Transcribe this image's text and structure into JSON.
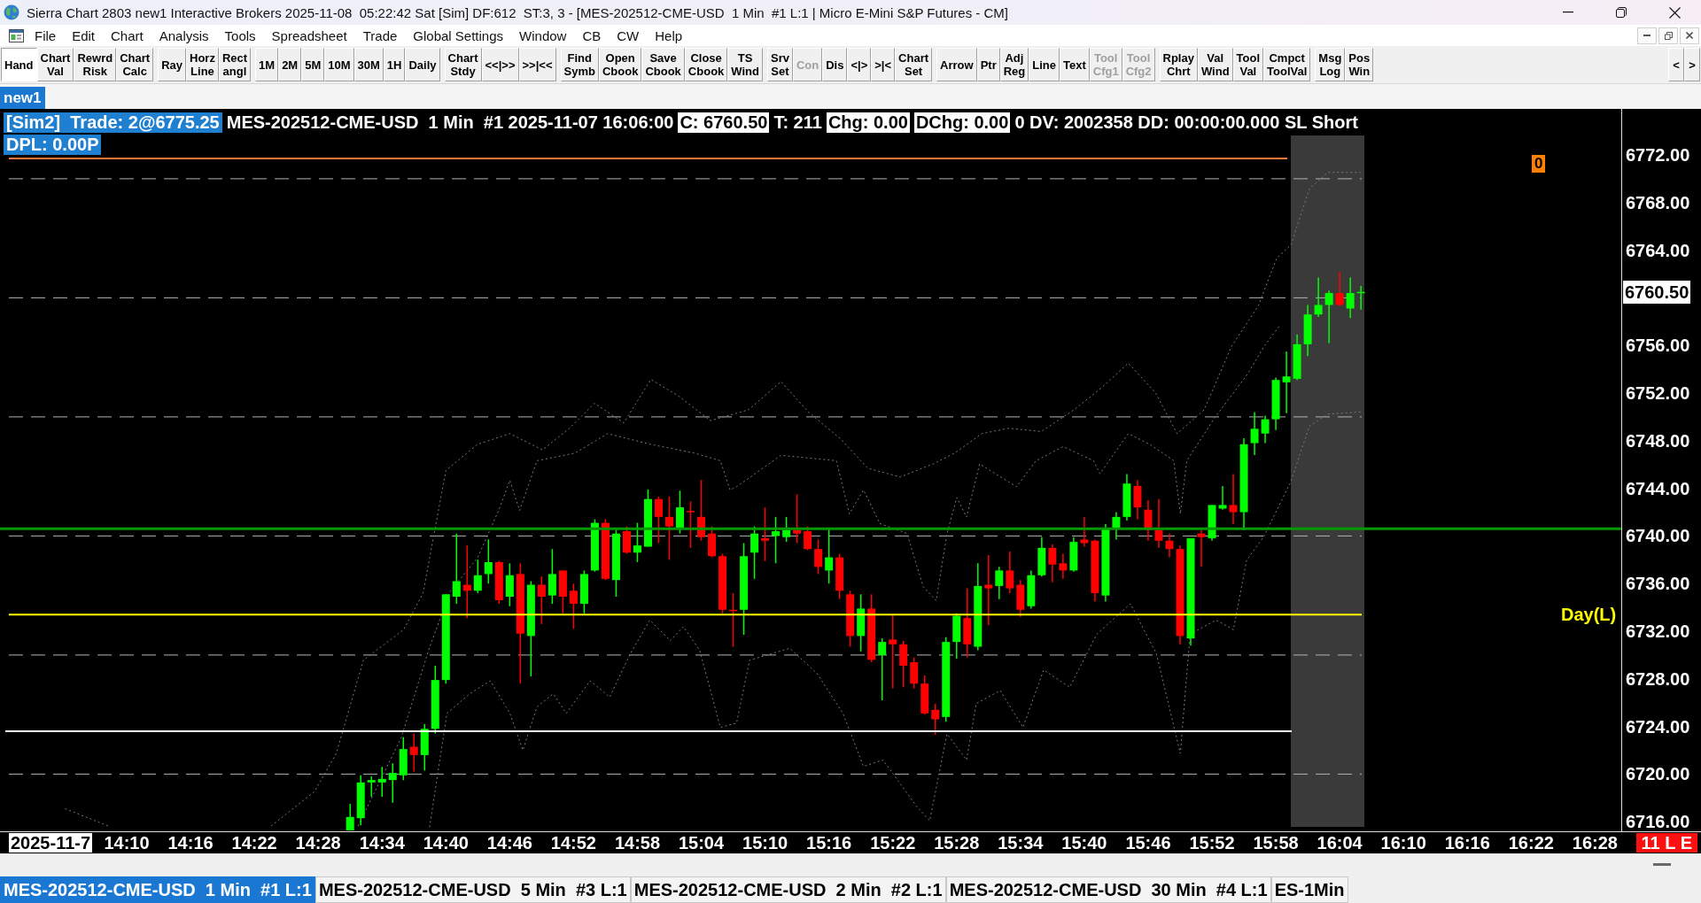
{
  "window": {
    "title": "Sierra Chart 2803 new1 Interactive Brokers 2025-11-08  05:22:42 Sat [Sim] DF:612  ST:3, 3 - [MES-202512-CME-USD  1 Min  #1 L:1 | Micro E-Mini S&P Futures - CM]"
  },
  "menu_bar": {
    "items": [
      "File",
      "Edit",
      "Chart",
      "Analysis",
      "Tools",
      "Spreadsheet",
      "Trade",
      "Global Settings",
      "Window",
      "CB",
      "CW",
      "Help"
    ]
  },
  "toolbar": {
    "groups": [
      [
        {
          "lines": [
            "Hand"
          ],
          "selected": true,
          "disabled": false
        },
        {
          "lines": [
            "Chart",
            "Val"
          ],
          "selected": false,
          "disabled": false
        },
        {
          "lines": [
            "Rewrd",
            "Risk"
          ],
          "selected": false,
          "disabled": false
        },
        {
          "lines": [
            "Chart",
            "Calc"
          ],
          "selected": false,
          "disabled": false
        }
      ],
      [
        {
          "lines": [
            "Ray"
          ],
          "selected": false,
          "disabled": false
        },
        {
          "lines": [
            "Horz",
            "Line"
          ],
          "selected": false,
          "disabled": false
        },
        {
          "lines": [
            "Rect",
            "angl"
          ],
          "selected": false,
          "disabled": false
        }
      ],
      [
        {
          "lines": [
            "1M"
          ],
          "selected": false,
          "disabled": false
        },
        {
          "lines": [
            "2M"
          ],
          "selected": false,
          "disabled": false
        },
        {
          "lines": [
            "5M"
          ],
          "selected": false,
          "disabled": false
        },
        {
          "lines": [
            "10M"
          ],
          "selected": false,
          "disabled": false
        },
        {
          "lines": [
            "30M"
          ],
          "selected": false,
          "disabled": false
        },
        {
          "lines": [
            "1H"
          ],
          "selected": false,
          "disabled": false
        },
        {
          "lines": [
            "Daily"
          ],
          "selected": false,
          "disabled": false
        }
      ],
      [
        {
          "lines": [
            "Chart",
            "Stdy"
          ],
          "selected": false,
          "disabled": false
        },
        {
          "lines": [
            "<<|>>"
          ],
          "selected": false,
          "disabled": false
        },
        {
          "lines": [
            ">>|<<"
          ],
          "selected": false,
          "disabled": false
        }
      ],
      [
        {
          "lines": [
            "Find",
            "Symb"
          ],
          "selected": false,
          "disabled": false
        },
        {
          "lines": [
            "Open",
            "Cbook"
          ],
          "selected": false,
          "disabled": false
        },
        {
          "lines": [
            "Save",
            "Cbook"
          ],
          "selected": false,
          "disabled": false
        },
        {
          "lines": [
            "Close",
            "Cbook"
          ],
          "selected": false,
          "disabled": false
        },
        {
          "lines": [
            "TS",
            "Wind"
          ],
          "selected": false,
          "disabled": false
        }
      ],
      [
        {
          "lines": [
            "Srv",
            "Set"
          ],
          "selected": false,
          "disabled": false
        },
        {
          "lines": [
            "Con"
          ],
          "selected": false,
          "disabled": true
        },
        {
          "lines": [
            "Dis"
          ],
          "selected": false,
          "disabled": false
        },
        {
          "lines": [
            "<|>"
          ],
          "selected": false,
          "disabled": false
        },
        {
          "lines": [
            ">|<"
          ],
          "selected": false,
          "disabled": false
        },
        {
          "lines": [
            "Chart",
            "Set"
          ],
          "selected": false,
          "disabled": false
        }
      ],
      [
        {
          "lines": [
            "Arrow"
          ],
          "selected": false,
          "disabled": false
        },
        {
          "lines": [
            "Ptr"
          ],
          "selected": false,
          "disabled": false
        },
        {
          "lines": [
            "Adj",
            "Reg"
          ],
          "selected": false,
          "disabled": false
        },
        {
          "lines": [
            "Line"
          ],
          "selected": false,
          "disabled": false
        },
        {
          "lines": [
            "Text"
          ],
          "selected": false,
          "disabled": false
        },
        {
          "lines": [
            "Tool",
            "Cfg1"
          ],
          "selected": false,
          "disabled": true
        },
        {
          "lines": [
            "Tool",
            "Cfg2"
          ],
          "selected": false,
          "disabled": true
        }
      ],
      [
        {
          "lines": [
            "Rplay",
            "Chrt"
          ],
          "selected": false,
          "disabled": false
        },
        {
          "lines": [
            "Val",
            "Wind"
          ],
          "selected": false,
          "disabled": false
        },
        {
          "lines": [
            "Tool",
            "Val"
          ],
          "selected": false,
          "disabled": false
        },
        {
          "lines": [
            "Cmpct",
            "ToolVal"
          ],
          "selected": false,
          "disabled": false
        }
      ],
      [
        {
          "lines": [
            "Msg",
            "Log"
          ],
          "selected": false,
          "disabled": false
        },
        {
          "lines": [
            "Pos",
            "Win"
          ],
          "selected": false,
          "disabled": false
        }
      ]
    ],
    "scroll_buttons": [
      "<",
      ">"
    ]
  },
  "chart_tabs": [
    {
      "label": "new1",
      "selected": true
    }
  ],
  "chart": {
    "header_lines": [
      [
        {
          "kind": "highlight",
          "text": "[Sim2]  Trade: 2@6775.25"
        },
        {
          "kind": "plain",
          "text": "MES-202512-CME-USD  1 Min  #1 2025-11-07 16:06:00"
        },
        {
          "kind": "boxed",
          "text": "C: 6760.50"
        },
        {
          "kind": "plain",
          "text": "T: 211"
        },
        {
          "kind": "boxed",
          "text": "Chg: 0.00"
        },
        {
          "kind": "boxed",
          "text": "DChg: 0.00"
        },
        {
          "kind": "plain",
          "text": "0 DV: 2002358 DD: 00:00:00.000 SL Short"
        }
      ],
      [
        {
          "kind": "highlight",
          "text": "DPL: 0.00P"
        }
      ]
    ],
    "count_badge": "0",
    "level_label": "Day(L)",
    "price_axis": [
      {
        "kind": "tick",
        "text": "6772.00"
      },
      {
        "kind": "tick",
        "text": "6768.00"
      },
      {
        "kind": "tick",
        "text": "6764.00"
      },
      {
        "kind": "last_price",
        "text": "6760.50"
      },
      {
        "kind": "tick",
        "text": "6756.00"
      },
      {
        "kind": "tick",
        "text": "6752.00"
      },
      {
        "kind": "tick",
        "text": "6748.00"
      },
      {
        "kind": "tick",
        "text": "6744.00"
      },
      {
        "kind": "tick",
        "text": "6740.00"
      },
      {
        "kind": "tick",
        "text": "6736.00"
      },
      {
        "kind": "tick",
        "text": "6732.00"
      },
      {
        "kind": "tick",
        "text": "6728.00"
      },
      {
        "kind": "tick",
        "text": "6724.00"
      },
      {
        "kind": "tick",
        "text": "6720.00"
      },
      {
        "kind": "tick",
        "text": "6716.00"
      }
    ],
    "time_axis": {
      "date": "2025-11-7",
      "labels": [
        "14:10",
        "14:16",
        "14:22",
        "14:28",
        "14:34",
        "14:40",
        "14:46",
        "14:52",
        "14:58",
        "15:04",
        "15:10",
        "15:16",
        "15:22",
        "15:28",
        "15:34",
        "15:40",
        "15:46",
        "15:52",
        "15:58",
        "16:04",
        "16:10",
        "16:16",
        "16:22",
        "16:28"
      ]
    },
    "status_badge": "11 L E"
  },
  "bottom_tabs": [
    {
      "label": "MES-202512-CME-USD  1 Min  #1 L:1",
      "selected": true
    },
    {
      "label": "MES-202512-CME-USD  5 Min  #3 L:1",
      "selected": false
    },
    {
      "label": "MES-202512-CME-USD  2 Min  #2 L:1",
      "selected": false
    },
    {
      "label": "MES-202512-CME-USD  30 Min  #4 L:1",
      "selected": false
    },
    {
      "label": "ES-1Min",
      "selected": false
    }
  ]
}
